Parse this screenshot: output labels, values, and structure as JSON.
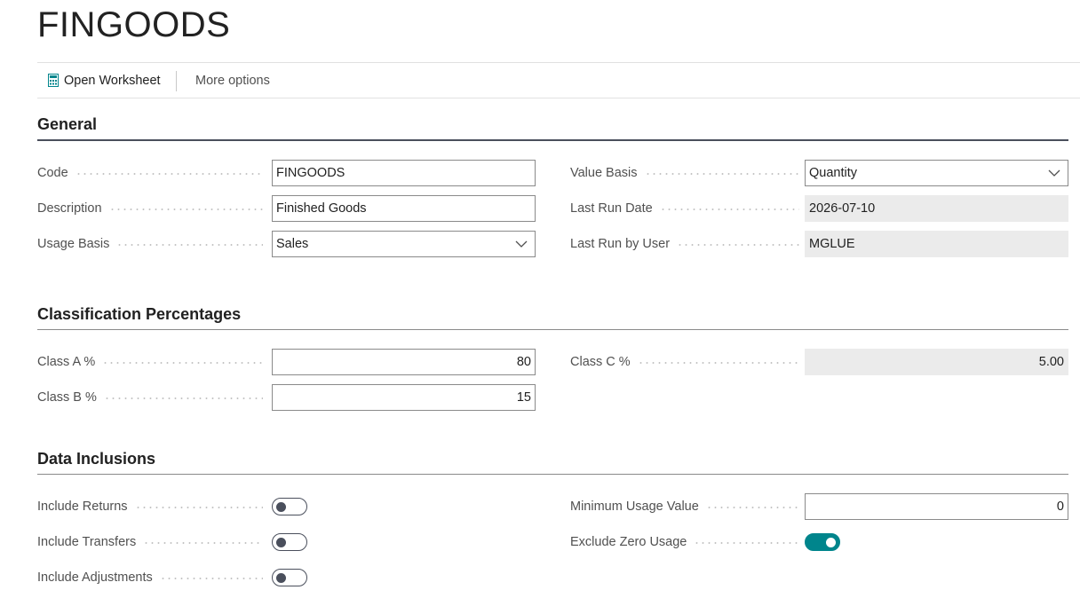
{
  "page": {
    "title": "FINGOODS"
  },
  "actions": {
    "open_worksheet": "Open Worksheet",
    "more_options": "More options"
  },
  "general": {
    "title": "General",
    "code": {
      "label": "Code",
      "value": "FINGOODS"
    },
    "description": {
      "label": "Description",
      "value": "Finished Goods"
    },
    "usage_basis": {
      "label": "Usage Basis",
      "value": "Sales"
    },
    "value_basis": {
      "label": "Value Basis",
      "value": "Quantity"
    },
    "last_run_date": {
      "label": "Last Run Date",
      "value": "2026-07-10"
    },
    "last_run_by_user": {
      "label": "Last Run by User",
      "value": "MGLUE"
    }
  },
  "classification": {
    "title": "Classification Percentages",
    "class_a": {
      "label": "Class A %",
      "value": "80"
    },
    "class_b": {
      "label": "Class B %",
      "value": "15"
    },
    "class_c": {
      "label": "Class C %",
      "value": "5.00"
    }
  },
  "data_inclusions": {
    "title": "Data Inclusions",
    "include_returns": {
      "label": "Include Returns",
      "on": false
    },
    "include_transfers": {
      "label": "Include Transfers",
      "on": false
    },
    "include_adjustments": {
      "label": "Include Adjustments",
      "on": false
    },
    "minimum_usage_value": {
      "label": "Minimum Usage Value",
      "value": "0"
    },
    "exclude_zero_usage": {
      "label": "Exclude Zero Usage",
      "on": true
    }
  },
  "colors": {
    "accent": "#00858c",
    "toggle_off": "#4a4f5c",
    "readonly_bg": "#ebebeb"
  },
  "icons": {
    "worksheet": "worksheet-icon",
    "dropdown": "chevron-down-icon"
  }
}
